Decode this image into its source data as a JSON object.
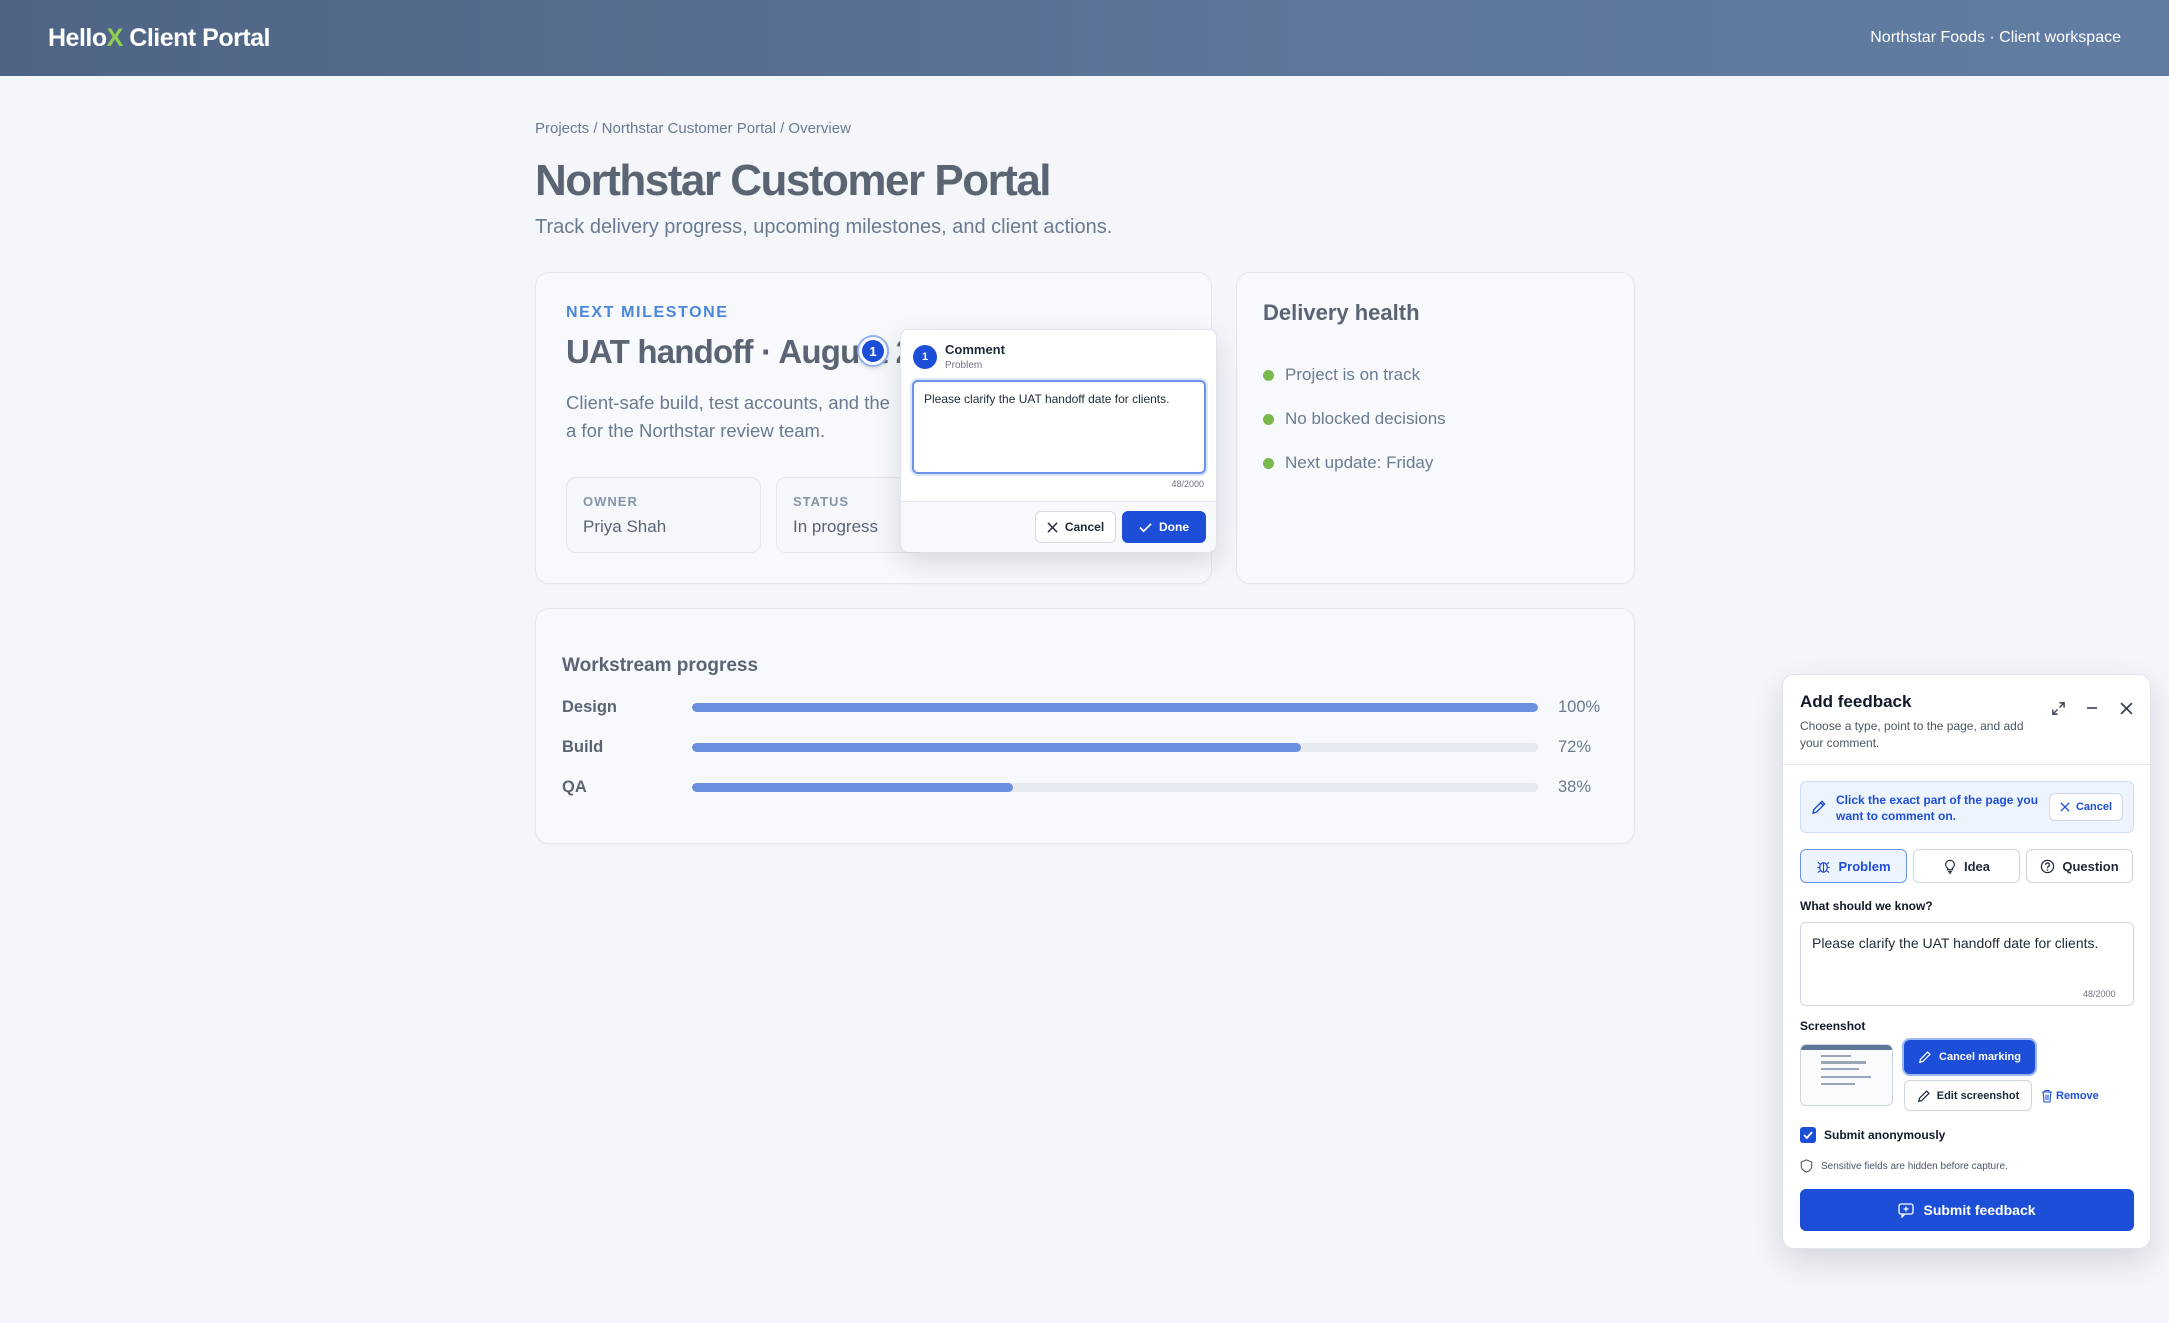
{
  "header": {
    "brand_prefix": "Hello",
    "brand_x": "X",
    "brand_suffix": " Client Portal",
    "workspace": "Northstar Foods · Client workspace"
  },
  "page": {
    "breadcrumb": "Projects / Northstar Customer Portal / Overview",
    "title": "Northstar Customer Portal",
    "subtitle": "Track delivery progress, upcoming milestones, and client actions."
  },
  "milestone": {
    "eyebrow": "NEXT MILESTONE",
    "title": "UAT handoff · August 2",
    "description": "Client-safe build, test accounts, and the a for the Northstar review team.",
    "owner_label": "OWNER",
    "owner_value": "Priya Shah",
    "status_label": "STATUS",
    "status_value": "In progress"
  },
  "health": {
    "title": "Delivery health",
    "items": [
      "Project is on track",
      "No blocked decisions",
      "Next update: Friday"
    ],
    "dot_color": "#79b84a"
  },
  "progress": {
    "title": "Workstream progress",
    "rows": [
      {
        "label": "Design",
        "pct_text": "100%",
        "fraction": 1.0
      },
      {
        "label": "Build",
        "pct_text": "72%",
        "fraction": 0.72
      },
      {
        "label": "QA",
        "pct_text": "38%",
        "fraction": 0.38
      }
    ],
    "bar_color": "#6a8fde"
  },
  "marker": {
    "number": "1"
  },
  "comment_popover": {
    "badge": "1",
    "title": "Comment",
    "type": "Problem",
    "text": "Please clarify the UAT handoff date for clients.",
    "count": "48/2000",
    "cancel_label": "Cancel",
    "done_label": "Done"
  },
  "feedback_panel": {
    "title": "Add feedback",
    "description": "Choose a type, point to the page, and add your comment.",
    "hint_text": "Click the exact part of the page you want to comment on.",
    "hint_cancel": "Cancel",
    "types": [
      "Problem",
      "Idea",
      "Question"
    ],
    "selected_type": "Problem",
    "field_label": "What should we know?",
    "text": "Please clarify the UAT handoff date for clients.",
    "count": "48/2000",
    "screenshot_label": "Screenshot",
    "cancel_marking": "Cancel marking",
    "edit_screenshot": "Edit screenshot",
    "remove": "Remove",
    "anonymous_label": "Submit anonymously",
    "anonymous_checked": true,
    "privacy_note": "Sensitive fields are hidden before capture.",
    "submit_label": "Submit feedback",
    "accent_color": "#1d4ed8"
  }
}
